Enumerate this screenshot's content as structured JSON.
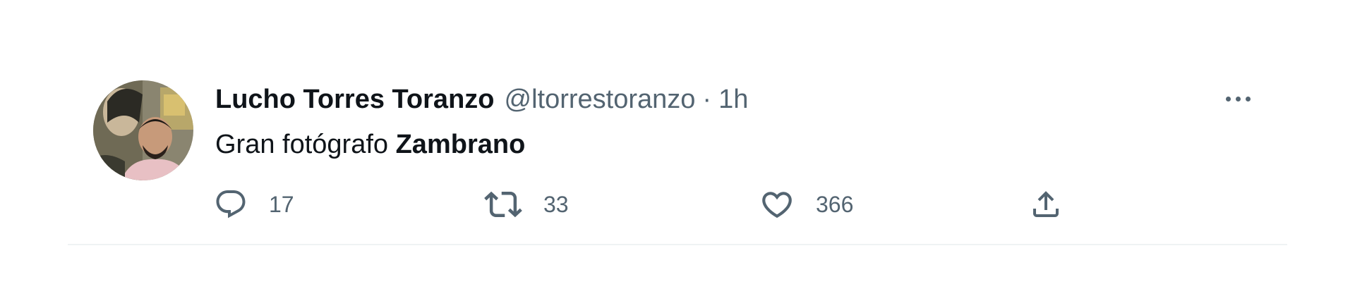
{
  "tweet": {
    "display_name": "Lucho Torres Toranzo",
    "handle": "@ltorrestoranzo",
    "separator": "·",
    "time": "1h",
    "text_plain": "Gran fotógrafo ",
    "text_bold": "Zambrano",
    "actions": {
      "reply_count": "17",
      "retweet_count": "33",
      "like_count": "366"
    }
  },
  "icons": {
    "more": "more-horizontal-icon",
    "reply": "reply-icon",
    "retweet": "retweet-icon",
    "like": "heart-icon",
    "share": "share-icon"
  },
  "colors": {
    "text_primary": "#0f1419",
    "text_secondary": "#536471",
    "divider": "#eff3f4"
  }
}
